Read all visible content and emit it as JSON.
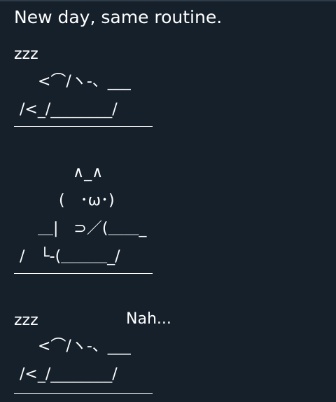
{
  "tweet": {
    "text": {
      "headline": "New day, same routine.",
      "sleep1": {
        "zzz": "zzz",
        "line1": "<⌒/ヽ-、___",
        "line2": "/<_/________/"
      },
      "cat": {
        "ears": "∧_∧",
        "face": "(　･ω･)",
        "arms": "＿|　⊃／(＿＿_",
        "body": "/　└-(＿＿＿_/"
      },
      "sleep2": {
        "zzz": "zzz",
        "nah": "Nah...",
        "line1": "<⌒/ヽ-、___",
        "line2": "/<_/________/"
      }
    }
  }
}
